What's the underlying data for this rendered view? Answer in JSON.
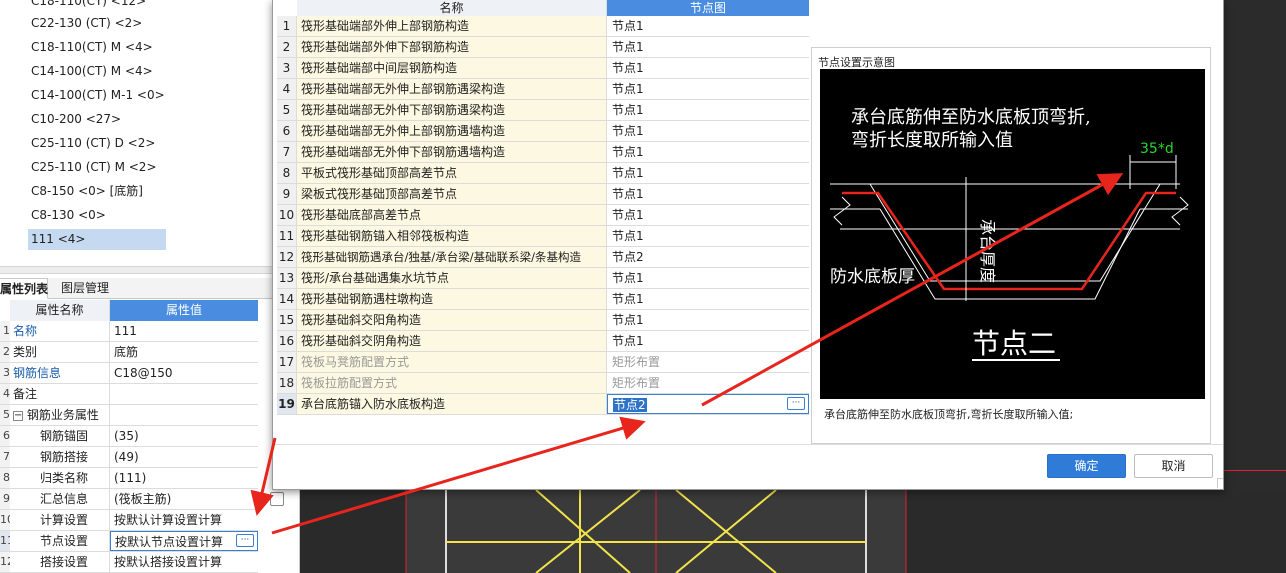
{
  "rebar_list": {
    "items": [
      {
        "label": "C18-110(CT) <12>"
      },
      {
        "label": "C22-130 (CT) <2>"
      },
      {
        "label": "C18-110(CT) M <4>"
      },
      {
        "label": "C14-100(CT) M <4>"
      },
      {
        "label": "C14-100(CT) M-1 <0>"
      },
      {
        "label": "C10-200 <27>"
      },
      {
        "label": "C25-110 (CT) D <2>"
      },
      {
        "label": "C25-110 (CT) M <2>"
      },
      {
        "label": "C8-150 <0> [底筋]"
      },
      {
        "label": "C8-130 <0>"
      },
      {
        "label": "111 <4>"
      }
    ]
  },
  "left_tabs": {
    "properties": "属性列表",
    "layers": "图层管理"
  },
  "prop_grid": {
    "header_name": "属性名称",
    "header_value": "属性值",
    "rows": [
      {
        "num": "1",
        "name": "名称",
        "value": "111"
      },
      {
        "num": "2",
        "name": "类别",
        "value": "底筋"
      },
      {
        "num": "3",
        "name": "钢筋信息",
        "value": "C18@150"
      },
      {
        "num": "4",
        "name": "备注",
        "value": ""
      },
      {
        "num": "5",
        "name": "钢筋业务属性",
        "value": "",
        "expander": "−"
      },
      {
        "num": "6",
        "name": "钢筋锚固",
        "value": "(35)"
      },
      {
        "num": "7",
        "name": "钢筋搭接",
        "value": "(49)"
      },
      {
        "num": "8",
        "name": "归类名称",
        "value": "(111)"
      },
      {
        "num": "9",
        "name": "汇总信息",
        "value": "(筏板主筋)"
      },
      {
        "num": "10",
        "name": "计算设置",
        "value": "按默认计算设置计算"
      },
      {
        "num": "11",
        "name": "节点设置",
        "value": "按默认节点设置计算"
      },
      {
        "num": "12",
        "name": "搭接设置",
        "value": "按默认搭接设置计算"
      }
    ]
  },
  "node_table": {
    "header_name": "名称",
    "header_value": "节点图",
    "rows": [
      {
        "num": "1",
        "name": "筏形基础端部外伸上部钢筋构造",
        "value": "节点1"
      },
      {
        "num": "2",
        "name": "筏形基础端部外伸下部钢筋构造",
        "value": "节点1"
      },
      {
        "num": "3",
        "name": "筏形基础端部中间层钢筋构造",
        "value": "节点1"
      },
      {
        "num": "4",
        "name": "筏形基础端部无外伸上部钢筋遇梁构造",
        "value": "节点1"
      },
      {
        "num": "5",
        "name": "筏形基础端部无外伸下部钢筋遇梁构造",
        "value": "节点1"
      },
      {
        "num": "6",
        "name": "筏形基础端部无外伸上部钢筋遇墙构造",
        "value": "节点1"
      },
      {
        "num": "7",
        "name": "筏形基础端部无外伸下部钢筋遇墙构造",
        "value": "节点1"
      },
      {
        "num": "8",
        "name": "平板式筏形基础顶部高差节点",
        "value": "节点1"
      },
      {
        "num": "9",
        "name": "梁板式筏形基础顶部高差节点",
        "value": "节点1"
      },
      {
        "num": "10",
        "name": "筏形基础底部高差节点",
        "value": "节点1"
      },
      {
        "num": "11",
        "name": "筏形基础钢筋锚入相邻筏板构造",
        "value": "节点1"
      },
      {
        "num": "12",
        "name": "筏形基础钢筋遇承台/独基/承台梁/基础联系梁/条基构造",
        "value": "节点2"
      },
      {
        "num": "13",
        "name": "筏形/承台基础遇集水坑节点",
        "value": "节点1"
      },
      {
        "num": "14",
        "name": "筏形基础钢筋遇柱墩构造",
        "value": "节点1"
      },
      {
        "num": "15",
        "name": "筏形基础斜交阳角构造",
        "value": "节点1"
      },
      {
        "num": "16",
        "name": "筏形基础斜交阴角构造",
        "value": "节点1"
      },
      {
        "num": "17",
        "name": "筏板马凳筋配置方式",
        "value": "矩形布置"
      },
      {
        "num": "18",
        "name": "筏板拉筋配置方式",
        "value": "矩形布置"
      },
      {
        "num": "19",
        "name": "承台底筋锚入防水底板构造",
        "value": "节点2"
      }
    ]
  },
  "preview": {
    "label": "节点设置示意图",
    "text_line1": "承台底筋伸至防水底板顶弯折,",
    "text_line2": "弯折长度取所输入值",
    "dim_label": "35*d",
    "thickness_label": "承台厚度",
    "slab_label": "防水底板厚",
    "node_title": "节点二",
    "caption": "承台底筋伸至防水底板顶弯折,弯折长度取所输入值;"
  },
  "buttons": {
    "ok": "确定",
    "cancel": "取消"
  },
  "ellipsis": "···",
  "colors": {
    "accent": "#2f7cd8",
    "selection": "#c5daf0",
    "arrow": "#e8251d",
    "rebar_red": "#e8251d",
    "dim_green": "#29d82d"
  }
}
